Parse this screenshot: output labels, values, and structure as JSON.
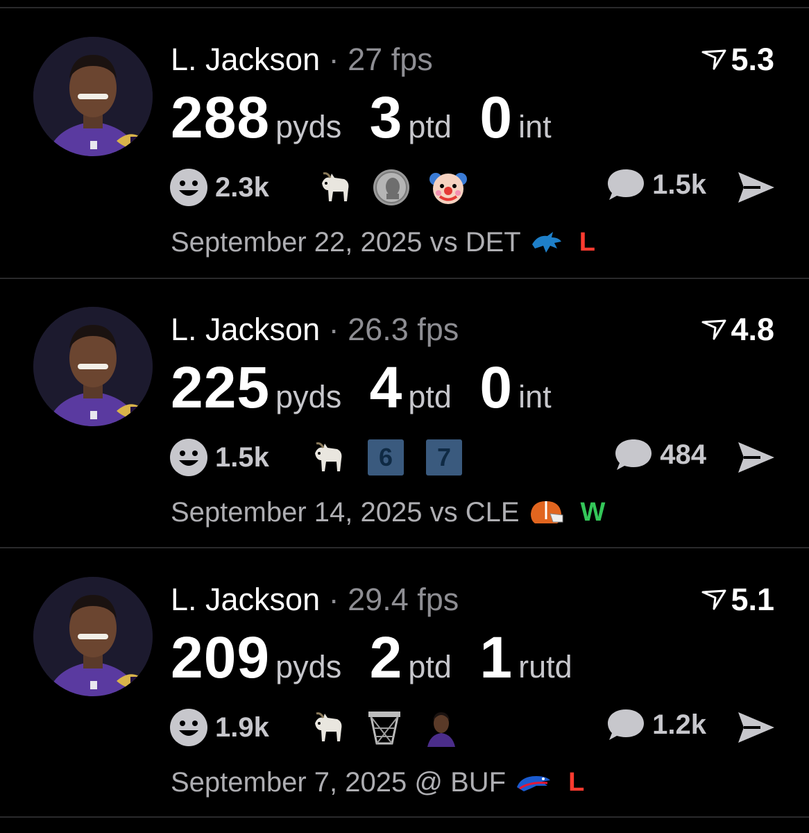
{
  "feed": {
    "posts": [
      {
        "player": "L. Jackson",
        "fps": "27 fps",
        "rating": "5.3",
        "stats": [
          {
            "value": "288",
            "unit": "pyds"
          },
          {
            "value": "3",
            "unit": "ptd"
          },
          {
            "value": "0",
            "unit": "int"
          }
        ],
        "reactions_count": "2.3k",
        "reaction_icons": [
          "goat-icon",
          "coin-icon",
          "clown-icon"
        ],
        "comments_count": "1.5k",
        "date": "September 22, 2025 vs DET",
        "opponent_logo": "lions-logo-icon",
        "result": "L"
      },
      {
        "player": "L. Jackson",
        "fps": "26.3 fps",
        "rating": "4.8",
        "stats": [
          {
            "value": "225",
            "unit": "pyds"
          },
          {
            "value": "4",
            "unit": "ptd"
          },
          {
            "value": "0",
            "unit": "int"
          }
        ],
        "reactions_count": "1.5k",
        "reaction_icons": [
          "goat-icon",
          "six-badge-icon",
          "seven-badge-icon"
        ],
        "badges": [
          "6",
          "7"
        ],
        "comments_count": "484",
        "date": "September 14, 2025 vs CLE",
        "opponent_logo": "browns-logo-icon",
        "result": "W"
      },
      {
        "player": "L. Jackson",
        "fps": "29.4 fps",
        "rating": "5.1",
        "stats": [
          {
            "value": "209",
            "unit": "pyds"
          },
          {
            "value": "2",
            "unit": "ptd"
          },
          {
            "value": "1",
            "unit": "rutd"
          }
        ],
        "reactions_count": "1.9k",
        "reaction_icons": [
          "goat-icon",
          "basketball-hoop-icon",
          "player-photo-icon"
        ],
        "comments_count": "1.2k",
        "date": "September 7, 2025 @ BUF",
        "opponent_logo": "bills-logo-icon",
        "result": "L"
      }
    ]
  },
  "colors": {
    "background": "#000000",
    "muted_text": "#8e8e93",
    "loss": "#ff3b30",
    "win": "#34c759",
    "ravens_purple": "#4b2d8a"
  }
}
